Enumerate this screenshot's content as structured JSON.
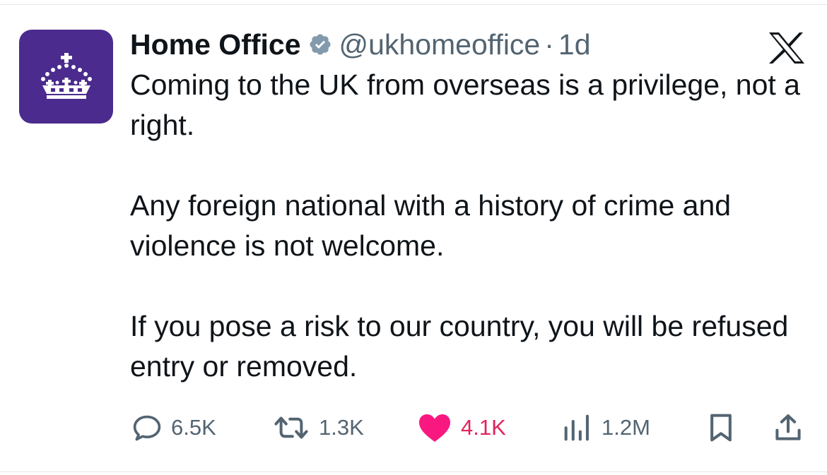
{
  "tweet": {
    "author": {
      "display_name": "Home Office",
      "verified": true,
      "handle": "@ukhomeoffice",
      "separator": "·",
      "time": "1d",
      "avatar_color": "#4b2b8e",
      "avatar_icon": "crown-icon"
    },
    "paragraphs": [
      "Coming to the UK from overseas is a privilege, not a right.",
      "Any foreign national with a history of crime and violence is not welcome.",
      "If you pose a risk to our country, you will be refused entry or removed."
    ],
    "stats": {
      "replies": "6.5K",
      "reposts": "1.3K",
      "likes": "4.1K",
      "views": "1.2M"
    },
    "liked": true
  },
  "icons": {
    "platform": "x-logo-icon",
    "reply": "reply-icon",
    "repost": "repost-icon",
    "like": "heart-icon",
    "views": "views-icon",
    "bookmark": "bookmark-icon",
    "share": "share-icon"
  },
  "colors": {
    "text": "#0f1419",
    "secondary": "#536471",
    "like": "#f91880",
    "verified": "#829aab"
  }
}
